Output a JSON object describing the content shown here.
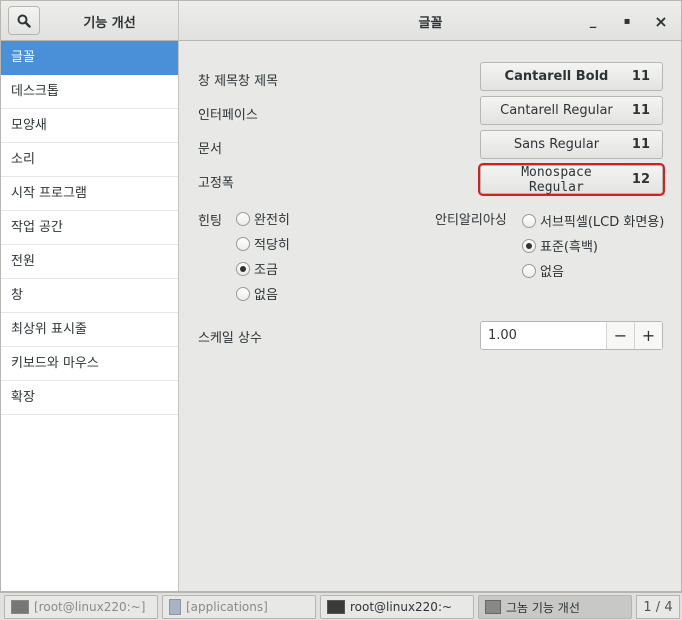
{
  "header": {
    "left_title": "기능 개선",
    "title": "글꼴",
    "search_icon": "search-icon",
    "minimize_label": "_",
    "maximize_label": "▪",
    "close_label": "×"
  },
  "sidebar": {
    "items": [
      {
        "label": "글꼴",
        "selected": true
      },
      {
        "label": "데스크톱"
      },
      {
        "label": "모양새"
      },
      {
        "label": "소리"
      },
      {
        "label": "시작 프로그램"
      },
      {
        "label": "작업 공간"
      },
      {
        "label": "전원"
      },
      {
        "label": "창"
      },
      {
        "label": "최상위 표시줄"
      },
      {
        "label": "키보드와 마우스"
      },
      {
        "label": "확장"
      }
    ]
  },
  "fonts": {
    "window_title": {
      "label": "창 제목창 제목",
      "font": "Cantarell Bold",
      "size": "11"
    },
    "interface": {
      "label": "인터페이스",
      "font": "Cantarell Regular",
      "size": "11"
    },
    "document": {
      "label": "문서",
      "font": "Sans Regular",
      "size": "11"
    },
    "monospace": {
      "label": "고정폭",
      "font": "Monospace Regular",
      "size": "12"
    }
  },
  "hinting": {
    "label": "힌팅",
    "options": [
      "완전히",
      "적당히",
      "조금",
      "없음"
    ],
    "selected": "조금"
  },
  "antialiasing": {
    "label": "안티알리아싱",
    "options": [
      "서브픽셀(LCD 화면용)",
      "표준(흑백)",
      "없음"
    ],
    "selected": "표준(흑백)"
  },
  "scale": {
    "label": "스케일 상수",
    "value": "1.00",
    "minus": "−",
    "plus": "+"
  },
  "taskbar": {
    "tasks": [
      {
        "label": "[root@linux220:~]",
        "state": "minimized"
      },
      {
        "label": "[applications]",
        "state": "minimized"
      },
      {
        "label": "root@linux220:~",
        "state": "normal"
      },
      {
        "label": "그놈 기능 개선",
        "state": "active"
      }
    ],
    "workspace": "1 / 4"
  },
  "colors": {
    "accent": "#4a90d9",
    "highlight_border": "#d21f1f"
  }
}
